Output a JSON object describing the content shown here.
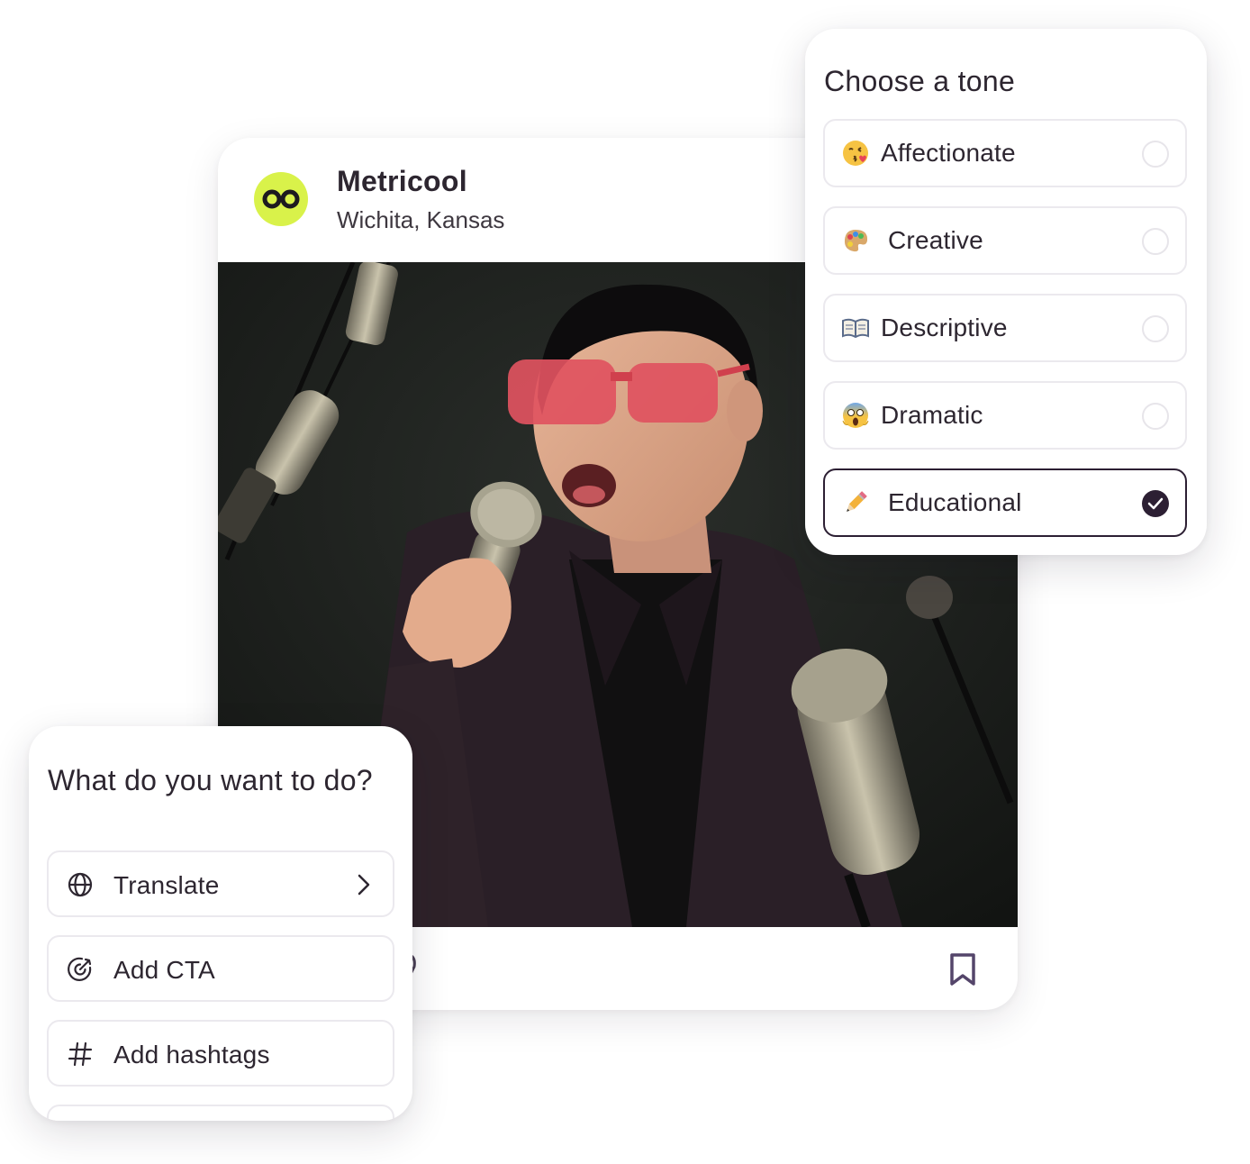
{
  "post": {
    "account_name": "Metricool",
    "location": "Wichita, Kansas",
    "avatar_color": "#d9f24a",
    "avatar_icon": "infinity-logo-icon",
    "save_icon": "bookmark-icon"
  },
  "tone_panel": {
    "title": "Choose a tone",
    "selected": "Educational",
    "options": [
      {
        "label": "Affectionate",
        "emoji": "😘",
        "selected": false
      },
      {
        "label": "Creative",
        "emoji": "🎨",
        "selected": false
      },
      {
        "label": "Descriptive",
        "emoji": "📖",
        "selected": false
      },
      {
        "label": "Dramatic",
        "emoji": "😱",
        "selected": false
      },
      {
        "label": "Educational",
        "emoji": "✏️",
        "selected": true
      }
    ],
    "accent_color": "#2c1f33"
  },
  "action_panel": {
    "title": "What do you want to do?",
    "options": [
      {
        "label": "Translate",
        "icon": "globe-icon",
        "has_submenu": true
      },
      {
        "label": "Add CTA",
        "icon": "target-icon",
        "has_submenu": false
      },
      {
        "label": "Add hashtags",
        "icon": "hash-icon",
        "has_submenu": false
      }
    ]
  }
}
